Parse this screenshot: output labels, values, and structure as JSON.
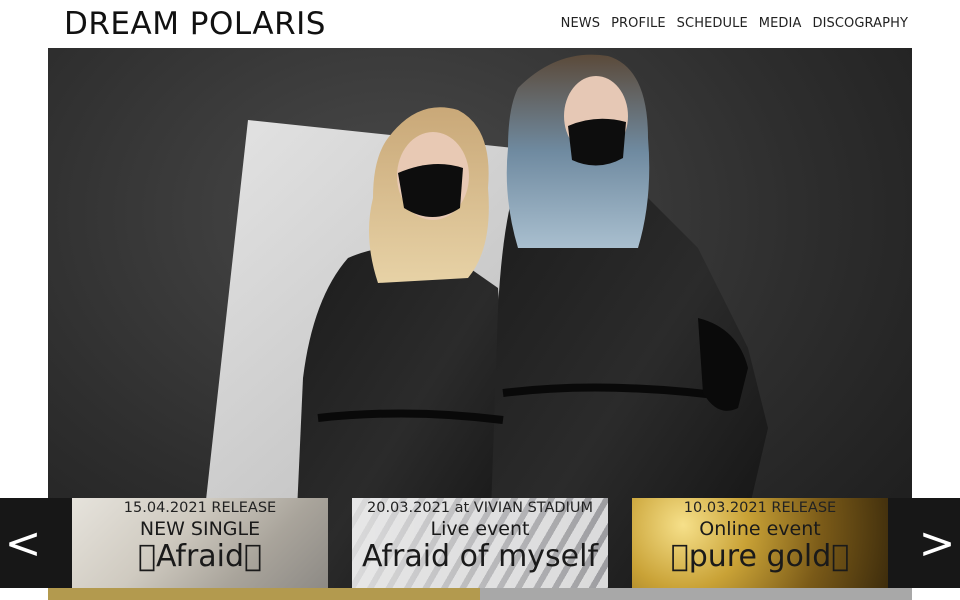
{
  "site": {
    "logo": "DREAM POLARIS"
  },
  "nav": {
    "items": [
      {
        "label": "NEWS"
      },
      {
        "label": "PROFILE"
      },
      {
        "label": "SCHEDULE"
      },
      {
        "label": "MEDIA"
      },
      {
        "label": "DISCOGRAPHY"
      }
    ]
  },
  "slider": {
    "prev_label": "<",
    "next_label": ">",
    "cards": [
      {
        "date": "15.04.2021 RELEASE",
        "subtitle": "NEW SINGLE",
        "title": "Afraid"
      },
      {
        "date": "20.03.2021 at VIVIAN STADIUM",
        "subtitle": "Live event",
        "title": "Afraid of myself"
      },
      {
        "date": "10.03.2021 RELEASE",
        "subtitle": "Online event",
        "title": "pure gold"
      }
    ],
    "progress": 0.5
  },
  "colors": {
    "progress_fill": "#b39a4e",
    "progress_track": "#a8a8a8",
    "arrow_bg": "#171717"
  }
}
